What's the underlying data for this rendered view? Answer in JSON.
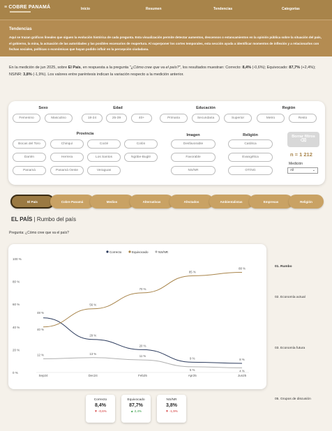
{
  "header": {
    "logo": "≡ COBRE PANAMÁ",
    "nav": [
      "Inicio",
      "Resumen",
      "Tendencias",
      "Categorías"
    ]
  },
  "tendencias": {
    "title": "Tendencias",
    "text": "Aquí se trazan gráficos lineales que siguen la evolución histórica de cada pregunta. Esta visualización permite detectar aumentos, descensos o estancamientos en la opinión pública sobre la situación del país, el gobierno, la mina, la actuación de las autoridades y las posibles escenarios de reapertura. Al superponer los cortes temporales, esta sección ayuda a identificar momentos de inflexión y a relacionarlos con fechas sociales, políticas o económicas que hayan podido influir en la percepción ciudadana."
  },
  "summary": {
    "p1": "En la medición de jun 2025, sobre ",
    "b1": "El País",
    "p2": ", en respuesta a la pregunta \"",
    "q": "¿Cómo cree que va el país?",
    "p3": "\", los resultados muestran: Correcto: ",
    "v1": "8,4%",
    "p4": " (-0,6%); Equivocado: ",
    "v2": "87,7%",
    "p5": " (+2,4%); NS/NR: ",
    "v3": "3,8%",
    "p6": " (-1,9%). Los valores entre paréntesis indican la variación respecto a la medición anterior."
  },
  "filters": {
    "sexo": {
      "title": "Sexo",
      "options": [
        "Femenino",
        "Masculino"
      ]
    },
    "edad": {
      "title": "Edad",
      "options": [
        "18-24",
        "25-39",
        "40+"
      ]
    },
    "educacion": {
      "title": "Educación",
      "options": [
        "Primaria",
        "Secundaria",
        "Superior"
      ]
    },
    "region": {
      "title": "Región",
      "options": [
        "Metro",
        "Resto"
      ]
    },
    "provincia": {
      "title": "Provincia",
      "options": [
        "Bocas del Toro",
        "Chiriquí",
        "Coclé",
        "Colón",
        "Darién",
        "Herrera",
        "Los Santos",
        "Ngöbe-Buglé",
        "Panamá",
        "Panamá Oeste",
        "Veraguas"
      ]
    },
    "imagen": {
      "title": "Imagen",
      "options": [
        "Desfavorable",
        "Favorable",
        "NS/NR"
      ]
    },
    "religion": {
      "title": "Religión",
      "options": [
        "Católica",
        "Evangélica",
        "OT/NG"
      ]
    },
    "borrar": "Borrar filtros",
    "n": "n = 1 212",
    "medicion_label": "Medición",
    "medicion_value": "All"
  },
  "tabs": [
    "El País",
    "Cobre Panamá",
    "Medios",
    "Alternativas",
    "Afectados",
    "Ambientalistas",
    "Empresas",
    "Religión"
  ],
  "section": {
    "title_bold": "EL PAÍS",
    "title_rest": " | Rumbo del país",
    "question": "Pregunta: ¿Cómo cree que va el país?"
  },
  "side_menu": [
    "01. Rumbo",
    "02. Economía actual",
    "03. Economía futura",
    "05. Grupos de discusión"
  ],
  "chart_data": {
    "type": "line",
    "categories": [
      "Sep24",
      "Dec24",
      "Feb25",
      "Apr25",
      "Jun25"
    ],
    "series": [
      {
        "name": "Correcto",
        "values": [
          48,
          29,
          20,
          9,
          8
        ],
        "color": "#2b3a5c"
      },
      {
        "name": "Equivocado",
        "values": [
          40,
          56,
          70,
          85,
          88
        ],
        "color": "#a8844a"
      },
      {
        "name": "NS/NR",
        "values": [
          12,
          13,
          11,
          5,
          4
        ],
        "color": "#b0b0b0"
      }
    ],
    "labels": [
      [
        "48 %",
        "29 %",
        "20 %",
        "9 %",
        "8 %"
      ],
      [
        "40 %",
        "56 %",
        "70 %",
        "85 %",
        "88 %"
      ],
      [
        "12 %",
        "13 %",
        "11 %",
        "5 %",
        "4 %"
      ]
    ],
    "yticks": [
      "0 %",
      "20 %",
      "40 %",
      "60 %",
      "80 %",
      "100 %"
    ],
    "ylim": [
      0,
      100
    ],
    "legend_position": "top"
  },
  "kpis": [
    {
      "label": "Correcto",
      "value": "8,4%",
      "delta": "▼ -0,6%",
      "trend": "neg"
    },
    {
      "label": "Equivocado",
      "value": "87,7%",
      "delta": "▲ 2,4%",
      "trend": "pos"
    },
    {
      "label": "NS/NR",
      "value": "3,8%",
      "delta": "▼ -1,9%",
      "trend": "neg"
    }
  ]
}
